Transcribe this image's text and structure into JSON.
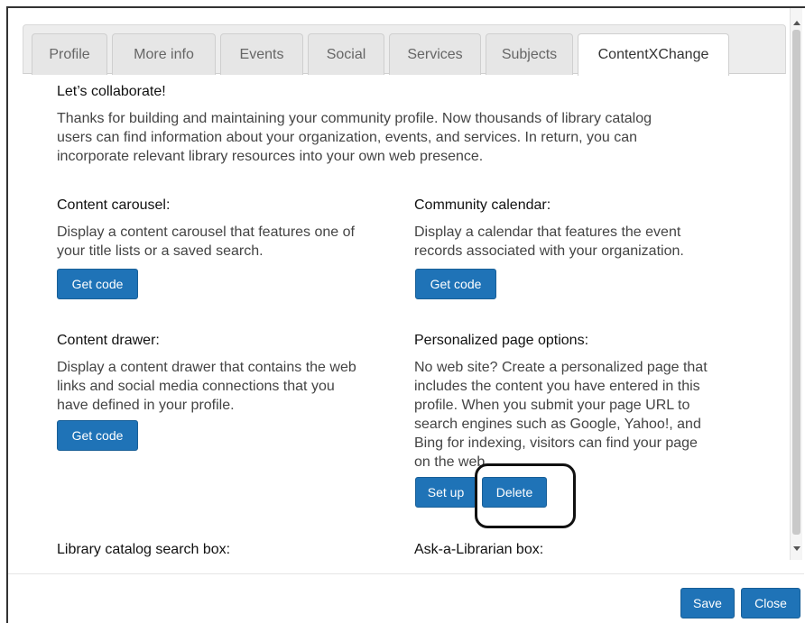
{
  "tabs": [
    {
      "label": "Profile"
    },
    {
      "label": "More info"
    },
    {
      "label": "Events"
    },
    {
      "label": "Social"
    },
    {
      "label": "Services"
    },
    {
      "label": "Subjects"
    },
    {
      "label": "ContentXChange",
      "active": true
    }
  ],
  "intro": {
    "heading": "Let’s collaborate!",
    "lines": [
      "Thanks for building and maintaining your community profile. Now thousands of library catalog",
      "users can find information about your organization, events, and services. In return, you can",
      "incorporate relevant library resources into your own web presence."
    ]
  },
  "sections": {
    "carousel": {
      "heading": "Content carousel:",
      "lines": [
        "Display a content carousel that features one of",
        "your title lists or a saved search."
      ],
      "button": "Get code"
    },
    "calendar": {
      "heading": "Community calendar:",
      "lines": [
        "Display a calendar that features the event",
        "records associated with your organization."
      ],
      "button": "Get code"
    },
    "drawer": {
      "heading": "Content drawer:",
      "lines": [
        "Display a content drawer that contains the web",
        "links and social media connections that you",
        "have defined in your profile."
      ],
      "button": "Get code"
    },
    "personalized": {
      "heading": "Personalized page options:",
      "lines": [
        "No web site? Create a personalized page that",
        "includes the content you have entered in this",
        "profile. When you submit your page URL to",
        "search engines such as Google, Yahoo!, and",
        "Bing for indexing, visitors can find your page",
        "on the web."
      ],
      "setup_button": "Set up",
      "delete_button": "Delete"
    },
    "catalog_search": {
      "heading": "Library catalog search box:"
    },
    "ask_librarian": {
      "heading": "Ask-a-Librarian box:"
    }
  },
  "footer": {
    "save": "Save",
    "close": "Close"
  },
  "colors": {
    "button_primary": "#1f73b7",
    "tab_bar": "#ededed",
    "highlight_ring": "#111111"
  }
}
